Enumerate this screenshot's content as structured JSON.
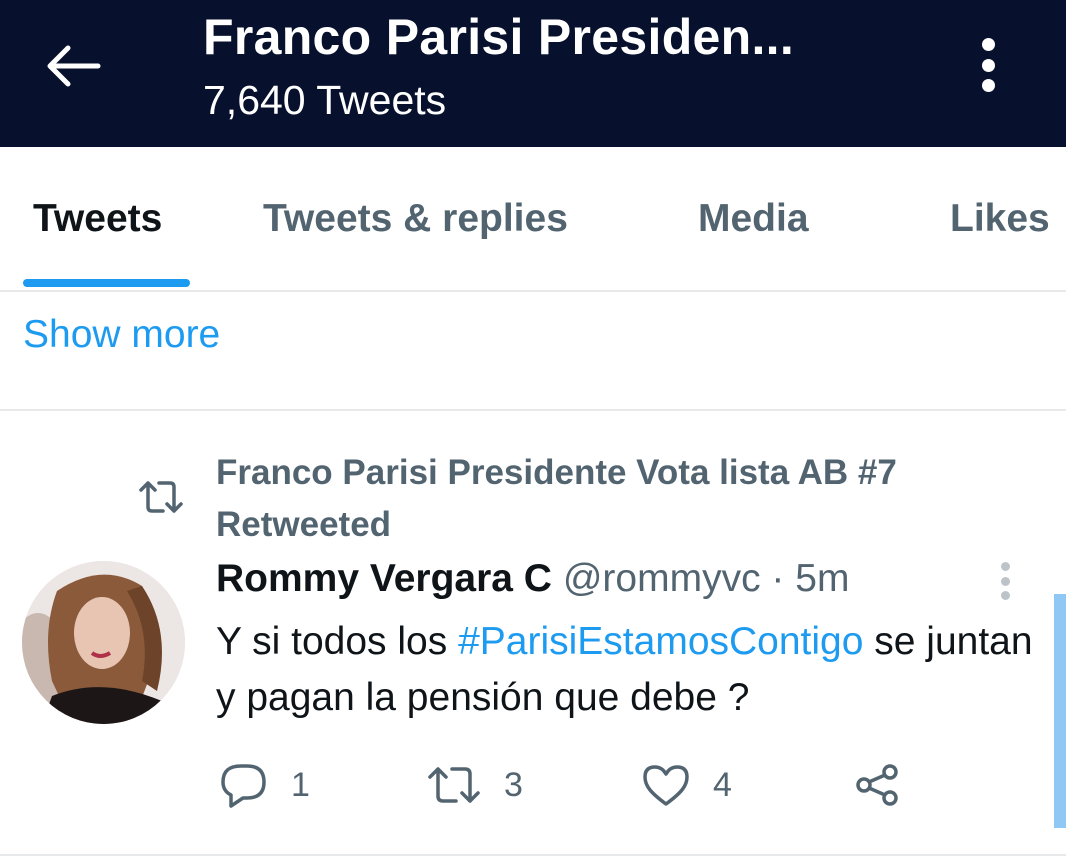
{
  "header": {
    "title": "Franco Parisi Presiden...",
    "tweet_count": "7,640 Tweets",
    "back_icon": "back-arrow-icon",
    "more_icon": "more-vertical-icon",
    "background": "#07112d"
  },
  "tabs": [
    {
      "label": "Tweets",
      "active": true
    },
    {
      "label": "Tweets & replies",
      "active": false
    },
    {
      "label": "Media",
      "active": false
    },
    {
      "label": "Likes",
      "active": false
    }
  ],
  "show_more": "Show more",
  "tweet": {
    "retweet_context": {
      "icon": "retweet-icon",
      "line1": "Franco Parisi Presidente Vota lista AB #7",
      "line2": "Retweeted"
    },
    "author_name": "Rommy Vergara C",
    "author_handle": "@rommyvc",
    "separator": "·",
    "time": "5m",
    "text_before": "Y si todos los ",
    "hashtag": "#ParisiEstamosContigo",
    "text_after": " se juntan y pagan la pensión que debe ?",
    "actions": {
      "reply_count": "1",
      "retweet_count": "3",
      "like_count": "4"
    }
  },
  "colors": {
    "accent": "#1d9bf0",
    "secondary_text": "#536471",
    "primary_text": "#0f1419"
  }
}
